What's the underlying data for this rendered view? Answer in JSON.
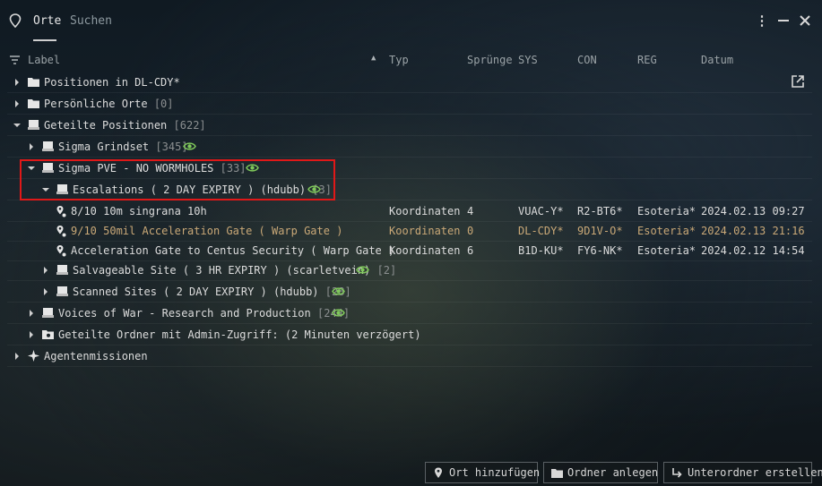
{
  "tabs": [
    {
      "label": "Orte",
      "active": true
    },
    {
      "label": "Suchen",
      "active": false
    }
  ],
  "columns": {
    "label": "Label",
    "typ": "Typ",
    "spruenge": "Sprünge",
    "sys": "SYS",
    "con": "CON",
    "reg": "REG",
    "datum": "Datum"
  },
  "tree": {
    "positionen": {
      "label": "Positionen in DL-CDY*"
    },
    "persoenlich": {
      "label": "Persönliche Orte",
      "count": "[0]"
    },
    "geteilt": {
      "label": "Geteilte Positionen",
      "count": "[622]"
    },
    "grindset": {
      "label": "Sigma Grindset",
      "count": "[345]"
    },
    "pve": {
      "label": "Sigma PVE - NO WORMHOLES",
      "count": "[33]"
    },
    "escalations": {
      "label": "Escalations ( 2 DAY EXPIRY ) (hdubb)",
      "count": "[3]"
    },
    "bookmarks": [
      {
        "label": "8/10 10m singrana 10h",
        "typ": "Koordinaten",
        "jumps": "4",
        "sys": "VUAC-Y*",
        "con": "R2-BT6*",
        "reg": "Esoteria*",
        "date": "2024.02.13 09:27"
      },
      {
        "label": "9/10 50mil Acceleration Gate ( Warp Gate )",
        "typ": "Koordinaten",
        "jumps": "0",
        "sys": "DL-CDY*",
        "con": "9D1V-O*",
        "reg": "Esoteria*",
        "date": "2024.02.13 21:16"
      },
      {
        "label": "Acceleration Gate to Centus Security ( Warp Gate )",
        "typ": "Koordinaten",
        "jumps": "6",
        "sys": "B1D-KU*",
        "con": "FY6-NK*",
        "reg": "Esoteria*",
        "date": "2024.02.12 14:54"
      }
    ],
    "salvage": {
      "label": "Salvageable Site ( 3 HR EXPIRY ) (scarletvein)",
      "count": "[2]"
    },
    "scanned": {
      "label": "Scanned Sites ( 2 DAY EXPIRY ) (hdubb)",
      "count": "[28]"
    },
    "voices": {
      "label": "Voices of War - Research and Production",
      "count": "[244]"
    },
    "admin": {
      "label": "Geteilte Ordner mit Admin-Zugriff: (2 Minuten verzögert)"
    },
    "agent": {
      "label": "Agentenmissionen"
    }
  },
  "buttons": {
    "add_location": "Ort hinzufügen",
    "create_folder": "Ordner anlegen",
    "create_subfolder": "Unterordner erstellen"
  },
  "colors": {
    "highlight": "#e01818",
    "eye_green": "#7fc85a",
    "orange_text": "#c9a877"
  },
  "icons": [
    "pin-icon",
    "kebab-menu-icon",
    "minimize-icon",
    "close-icon",
    "sort-icon",
    "export-icon",
    "folder-icon",
    "shared-folder-icon",
    "eye-icon",
    "bookmark-pin-icon",
    "star-icon"
  ]
}
